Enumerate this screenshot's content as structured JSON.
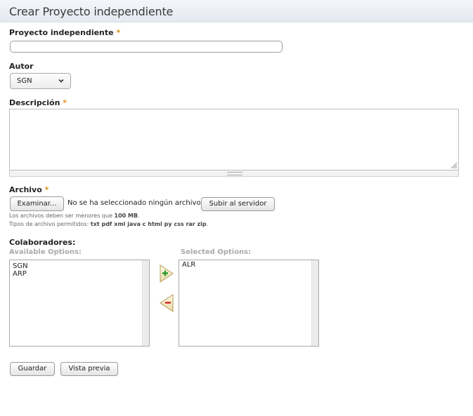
{
  "page": {
    "title": "Crear Proyecto independiente"
  },
  "form": {
    "project_label": "Proyecto independiente",
    "required_mark": "*",
    "project_value": "",
    "author_label": "Autor",
    "author_selected": "SGN",
    "description_label": "Descripción",
    "description_value": "",
    "file_label": "Archivo",
    "browse_button": "Examinar...",
    "no_file_text": "No se ha seleccionado ningún archivo.",
    "upload_button": "Subir al servidor",
    "size_note_prefix": "Los archivos deben ser menores que ",
    "size_note_value": "100 MB",
    "size_note_suffix": ".",
    "types_note_prefix": "Tipos de archivo permitidos: ",
    "types_note_value": "txt pdf xml java c html py css rar zip",
    "types_note_suffix": "."
  },
  "collaborators": {
    "label": "Colaboradores:",
    "available_label": "Available Options:",
    "selected_label": "Selected Options:",
    "available": [
      "SGN",
      "ARP"
    ],
    "selected": [
      "ALR"
    ],
    "add_icon": "green-plus-arrow-right",
    "remove_icon": "red-minus-arrow-left"
  },
  "actions": {
    "save_button": "Guardar",
    "preview_button": "Vista previa"
  }
}
